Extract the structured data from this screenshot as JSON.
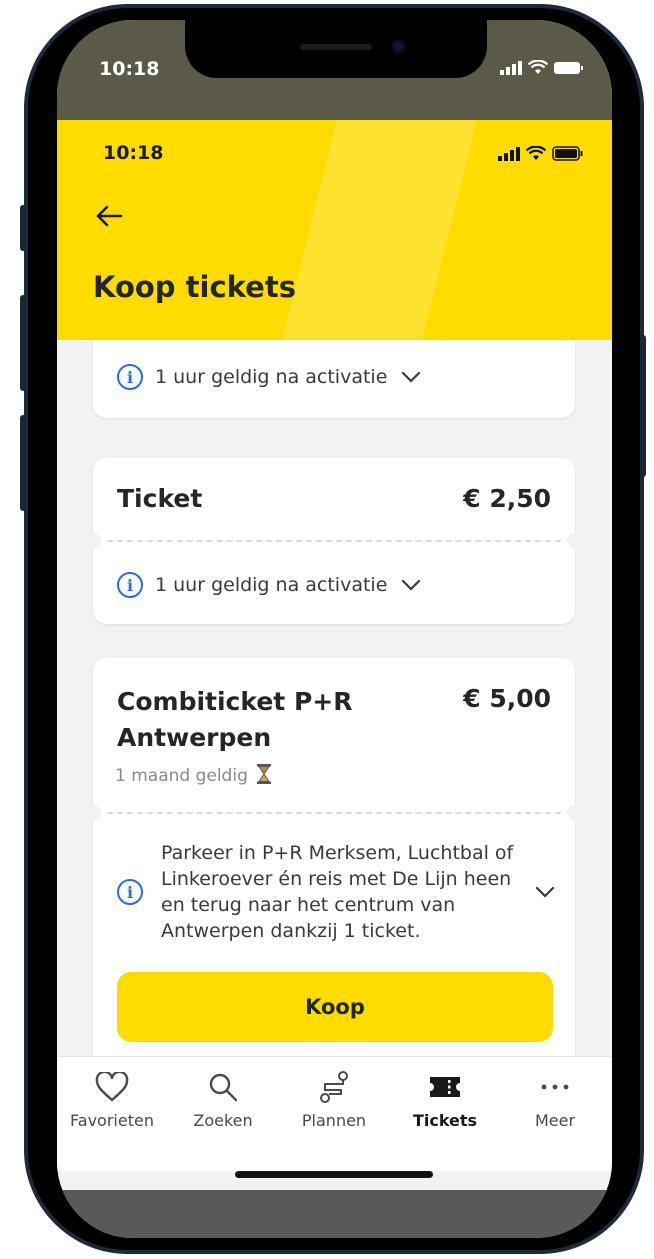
{
  "status": {
    "time": "10:18"
  },
  "header": {
    "title": "Koop tickets",
    "back_icon": "arrow-left-icon"
  },
  "tickets": [
    {
      "validity": "1 uur geldig na activatie"
    },
    {
      "name": "Ticket",
      "price": "€ 2,50",
      "validity": "1 uur geldig na activatie"
    },
    {
      "name": "Combiticket P+R Antwerpen",
      "price": "€ 5,00",
      "duration": "1 maand geldig",
      "duration_icon": "hourglass-icon",
      "description": "Parkeer in P+R Merksem, Luchtbal of Linkeroever én reis met De Lijn heen en terug naar het centrum van Antwerpen dankzij 1 ticket.",
      "buy_label": "Koop"
    }
  ],
  "tabbar": [
    {
      "label": "Favorieten",
      "icon": "heart-icon"
    },
    {
      "label": "Zoeken",
      "icon": "search-icon"
    },
    {
      "label": "Plannen",
      "icon": "route-icon"
    },
    {
      "label": "Tickets",
      "icon": "ticket-icon",
      "active": true
    },
    {
      "label": "Meer",
      "icon": "more-icon"
    }
  ],
  "colors": {
    "brand_yellow": "#ffdc00",
    "info_blue": "#2d6ae3",
    "text_dark": "#262626"
  }
}
